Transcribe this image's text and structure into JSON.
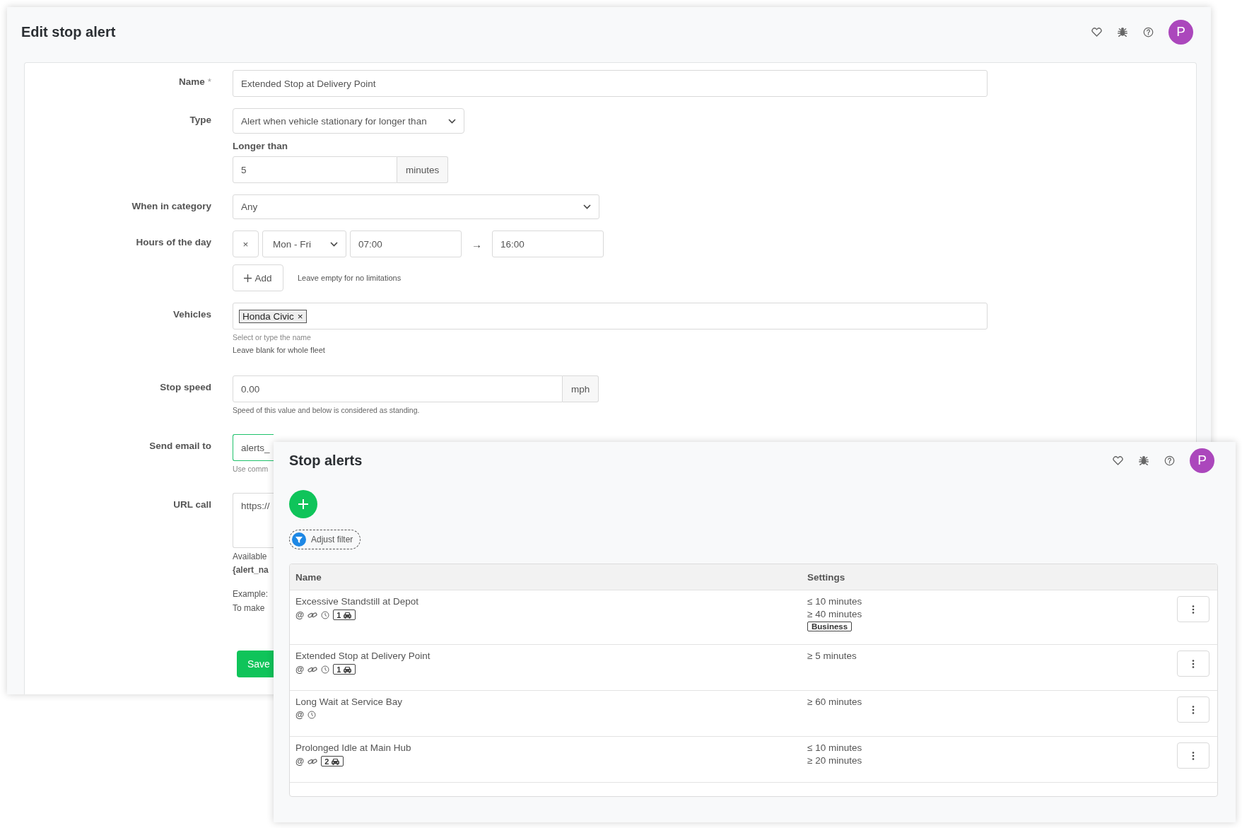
{
  "edit_window": {
    "title": "Edit stop alert",
    "avatar": "P",
    "form": {
      "name": {
        "label": "Name",
        "required_mark": "*",
        "value": "Extended Stop at Delivery Point"
      },
      "type": {
        "label": "Type",
        "value": "Alert when vehicle stationary for longer than"
      },
      "longer_than": {
        "label": "Longer than",
        "value": "5",
        "unit": "minutes"
      },
      "category": {
        "label": "When in category",
        "value": "Any"
      },
      "hours": {
        "label": "Hours of the day",
        "remove": "×",
        "days": "Mon - Fri",
        "from": "07:00",
        "arrow": "→",
        "to": "16:00",
        "add": "Add",
        "hint": "Leave empty for no limitations"
      },
      "vehicles": {
        "label": "Vehicles",
        "tags": [
          {
            "text": "Honda Civic",
            "remove": "×"
          }
        ],
        "hint": "Select or type the name",
        "note": "Leave blank for whole fleet"
      },
      "stop_speed": {
        "label": "Stop speed",
        "value": "0.00",
        "unit": "mph",
        "hint": "Speed of this value and below is considered as standing."
      },
      "email": {
        "label": "Send email to",
        "value": "alerts_",
        "focused": true,
        "hint": "Use comm"
      },
      "url": {
        "label": "URL call",
        "value": "https://",
        "variables_intro": "Available",
        "variables": "{alert_na",
        "example_lines": [
          "Example:",
          "To make"
        ]
      },
      "save": "Save"
    }
  },
  "alerts_window": {
    "title": "Stop alerts",
    "avatar": "P",
    "filter": "Adjust filter",
    "columns": [
      "Name",
      "Settings"
    ],
    "rows": [
      {
        "name": "Excessive Standstill at Depot",
        "indicators": [
          {
            "kind": "email",
            "text": "@"
          },
          {
            "kind": "url"
          },
          {
            "kind": "schedule"
          },
          {
            "kind": "vehicles",
            "text": "1"
          }
        ],
        "settings": [
          "≤ 10 minutes",
          "≥ 40 minutes"
        ],
        "category": "Business"
      },
      {
        "name": "Extended Stop at Delivery Point",
        "indicators": [
          {
            "kind": "email",
            "text": "@"
          },
          {
            "kind": "url"
          },
          {
            "kind": "schedule"
          },
          {
            "kind": "vehicles",
            "text": "1"
          }
        ],
        "settings": [
          "≥ 5 minutes"
        ]
      },
      {
        "name": "Long Wait at Service Bay",
        "indicators": [
          {
            "kind": "email",
            "text": "@"
          },
          {
            "kind": "schedule"
          }
        ],
        "settings": [
          "≥ 60 minutes"
        ]
      },
      {
        "name": "Prolonged Idle at Main Hub",
        "indicators": [
          {
            "kind": "email",
            "text": "@"
          },
          {
            "kind": "url"
          },
          {
            "kind": "vehicles",
            "text": "2"
          }
        ],
        "settings": [
          "≤ 10 minutes",
          "≥ 20 minutes"
        ]
      }
    ]
  }
}
